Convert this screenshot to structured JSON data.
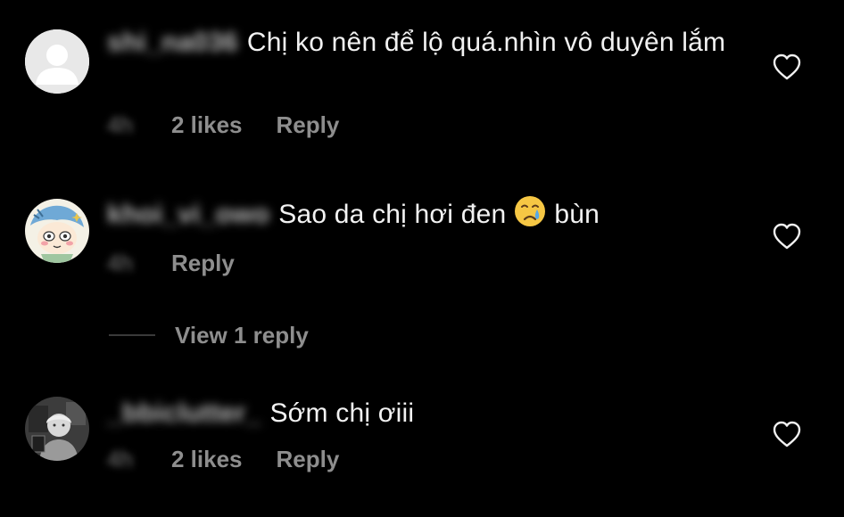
{
  "comments": [
    {
      "username": "shi_na036",
      "text": "Chị ko nên để lộ quá.nhìn vô duyên lắm",
      "time": "4h",
      "likes": "2 likes",
      "reply_label": "Reply",
      "avatar": "default-avatar-icon"
    },
    {
      "username": "khoi_vi_owo",
      "text_before": "Sao da chị hơi đen",
      "emoji": "crying-face-icon",
      "text_after": "bùn",
      "time": "4h",
      "reply_label": "Reply",
      "view_replies_label": "View 1 reply",
      "avatar": "cartoon-avatar"
    },
    {
      "username": "_bbiclutter_",
      "text": "Sớm chị ơiii",
      "time": "4h",
      "likes": "2 likes",
      "reply_label": "Reply",
      "avatar": "photo-avatar"
    }
  ],
  "colors": {
    "background": "#000000",
    "primary_text": "#f2f2f2",
    "secondary_text": "#8e8e8e"
  }
}
